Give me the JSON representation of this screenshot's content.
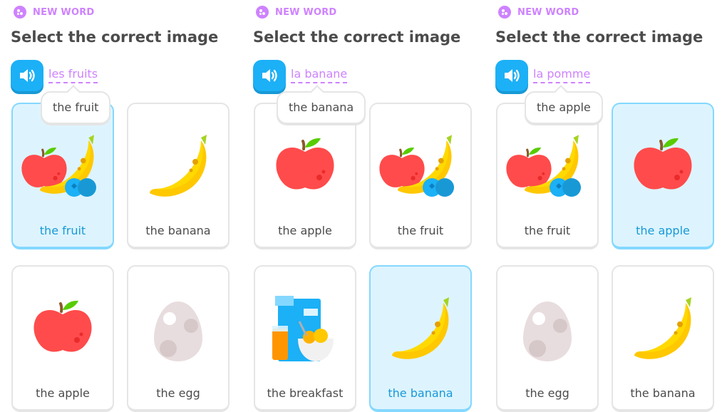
{
  "panels": [
    {
      "badge": "NEW WORD",
      "title": "Select the correct image",
      "word": "les fruits",
      "hint": "the fruit",
      "options": [
        {
          "label": "the fruit",
          "image": "fruit-icon",
          "selected": true
        },
        {
          "label": "the banana",
          "image": "banana-icon",
          "selected": false
        },
        {
          "label": "the apple",
          "image": "apple-icon",
          "selected": false
        },
        {
          "label": "the egg",
          "image": "egg-icon",
          "selected": false
        }
      ]
    },
    {
      "badge": "NEW WORD",
      "title": "Select the correct image",
      "word": "la banane",
      "hint": "the banana",
      "options": [
        {
          "label": "the apple",
          "image": "apple-icon",
          "selected": false
        },
        {
          "label": "the fruit",
          "image": "fruit-icon",
          "selected": false
        },
        {
          "label": "the breakfast",
          "image": "breakfast-icon",
          "selected": false
        },
        {
          "label": "the banana",
          "image": "banana-icon",
          "selected": true
        }
      ]
    },
    {
      "badge": "NEW WORD",
      "title": "Select the correct image",
      "word": "la pomme",
      "hint": "the apple",
      "options": [
        {
          "label": "the fruit",
          "image": "fruit-icon",
          "selected": false
        },
        {
          "label": "the apple",
          "image": "apple-icon",
          "selected": true
        },
        {
          "label": "the egg",
          "image": "egg-icon",
          "selected": false
        },
        {
          "label": "the banana",
          "image": "banana-icon",
          "selected": false
        }
      ]
    }
  ],
  "colors": {
    "accent_purple": "#ce82ff",
    "speaker_blue": "#1cb0f6",
    "selected_bg": "#ddf4ff",
    "selected_border": "#84d8ff",
    "selected_text": "#1899d6",
    "text": "#4b4b4b"
  }
}
